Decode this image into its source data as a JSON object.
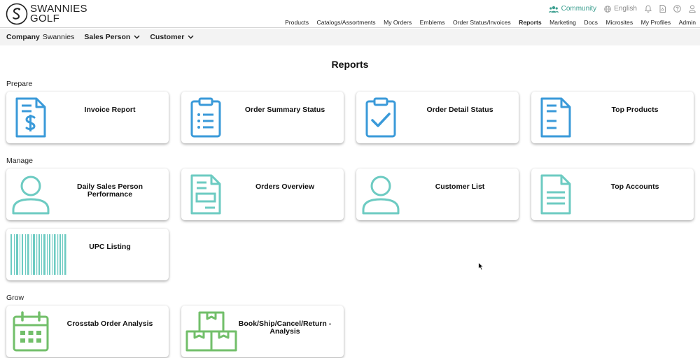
{
  "brand": {
    "line1": "SWANNIES",
    "line2": "GOLF"
  },
  "util": {
    "community": "Community",
    "language": "English"
  },
  "nav": [
    {
      "label": "Products",
      "active": false
    },
    {
      "label": "Catalogs/Assortments",
      "active": false
    },
    {
      "label": "My Orders",
      "active": false
    },
    {
      "label": "Emblems",
      "active": false
    },
    {
      "label": "Order Status/Invoices",
      "active": false
    },
    {
      "label": "Reports",
      "active": true
    },
    {
      "label": "Marketing",
      "active": false
    },
    {
      "label": "Docs",
      "active": false
    },
    {
      "label": "Microsites",
      "active": false
    },
    {
      "label": "My Profiles",
      "active": false
    },
    {
      "label": "Admin",
      "active": false
    }
  ],
  "filters": {
    "company_label": "Company",
    "company_value": "Swannies",
    "sales_person": "Sales Person",
    "customer": "Customer"
  },
  "page": {
    "title": "Reports"
  },
  "sections": {
    "prepare": "Prepare",
    "manage": "Manage",
    "grow": "Grow"
  },
  "cards": {
    "invoice_report": "Invoice Report",
    "order_summary_status": "Order Summary Status",
    "order_detail_status": "Order Detail Status",
    "top_products": "Top Products",
    "daily_sales_person_line1": "Daily Sales Person",
    "daily_sales_person_line2": "Performance",
    "orders_overview": "Orders Overview",
    "customer_list": "Customer List",
    "top_accounts": "Top Accounts",
    "upc_listing": "UPC Listing",
    "crosstab": "Crosstab Order Analysis",
    "book_ship_line1": "Book/Ship/Cancel/Return -",
    "book_ship_line2": "Analysis"
  },
  "colors": {
    "prepare_icon": "#3a9ad9",
    "manage_icon": "#6dcbc2",
    "grow_icon": "#72bf6a",
    "community": "#3a9e8f"
  }
}
